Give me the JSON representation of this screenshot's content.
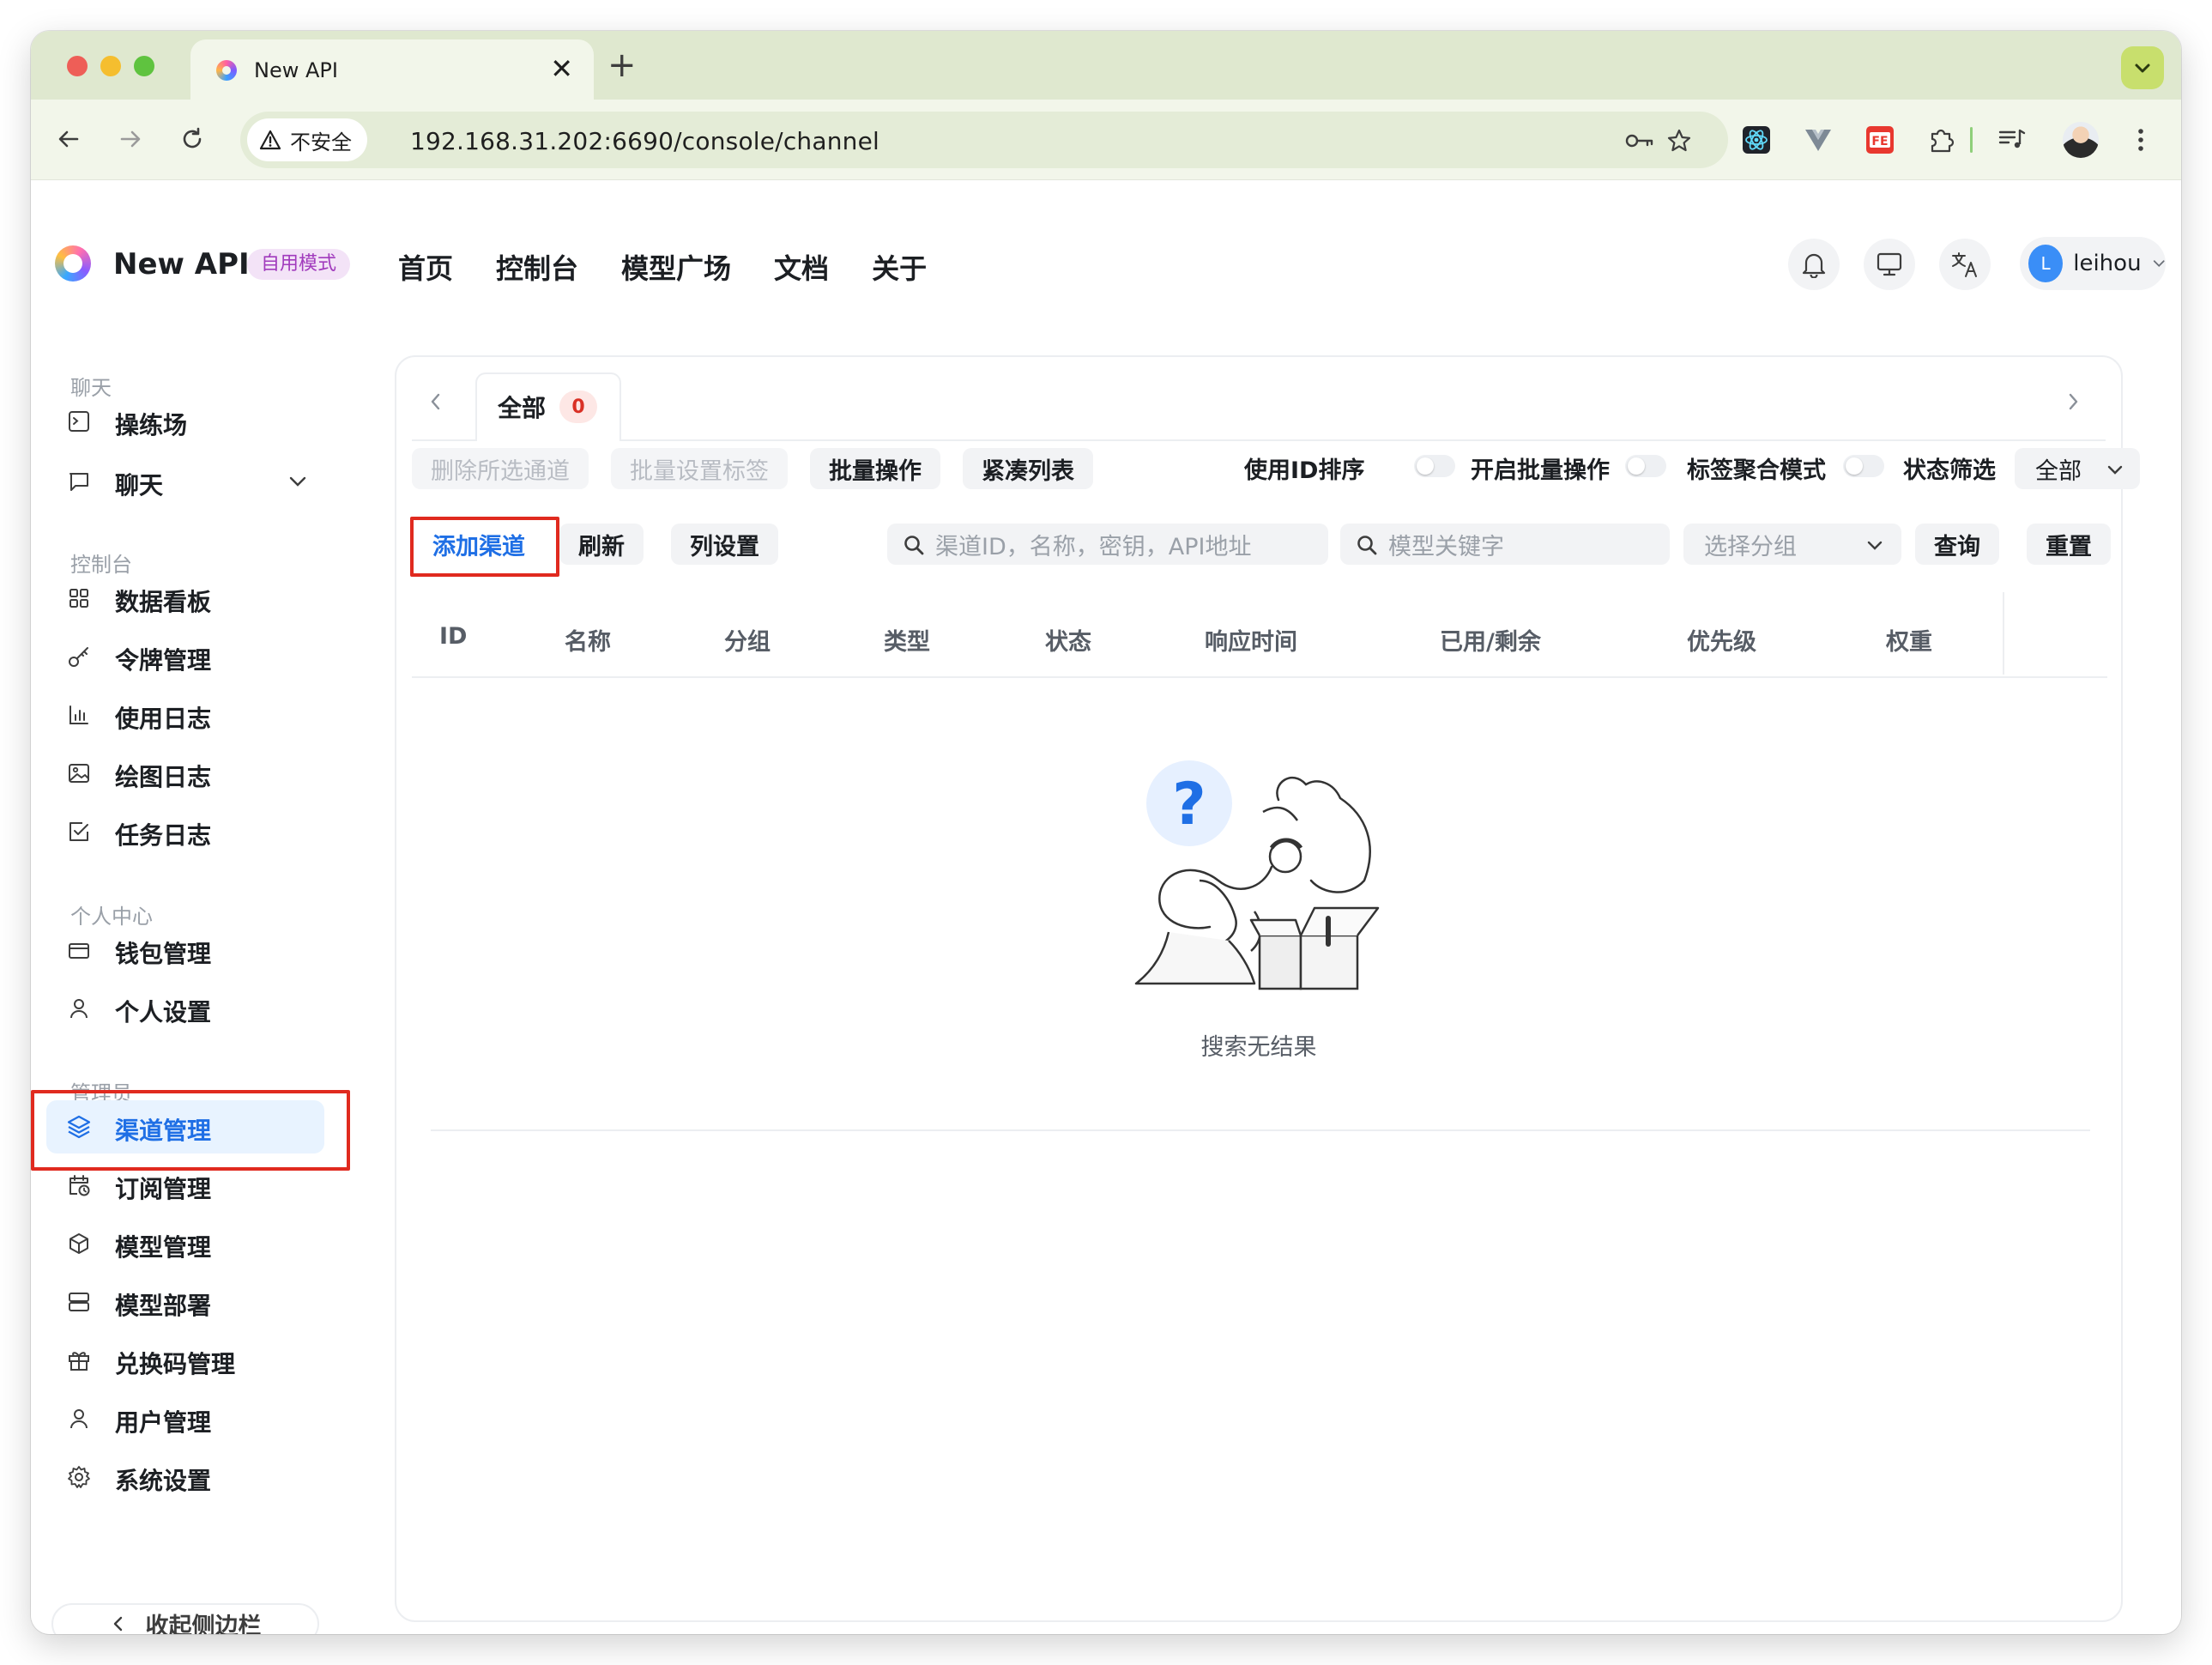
{
  "browser": {
    "tab_title": "New API",
    "tab_close": "✕",
    "new_tab": "+",
    "security_label": "不安全",
    "url": "192.168.31.202:6690/console/channel"
  },
  "header": {
    "brand": "New API",
    "brand_tag": "自用模式",
    "nav": [
      "首页",
      "控制台",
      "模型广场",
      "文档",
      "关于"
    ],
    "user_initial": "L",
    "user_name": "leihou"
  },
  "sidebar": {
    "groups": {
      "chat": "聊天",
      "console": "控制台",
      "personal": "个人中心",
      "admin": "管理员"
    },
    "items": {
      "playground": "操练场",
      "chat": "聊天",
      "dashboard": "数据看板",
      "tokens": "令牌管理",
      "usage_log": "使用日志",
      "drawing_log": "绘图日志",
      "task_log": "任务日志",
      "wallet": "钱包管理",
      "personal_settings": "个人设置",
      "channels": "渠道管理",
      "subscriptions": "订阅管理",
      "models": "模型管理",
      "deployment": "模型部署",
      "redemption": "兑换码管理",
      "users": "用户管理",
      "system_settings": "系统设置"
    },
    "collapse_label": "收起侧边栏"
  },
  "channel_page": {
    "tab_label": "全部",
    "tab_count": "0",
    "actions": {
      "delete_selected": "删除所选通道",
      "batch_tag": "批量设置标签",
      "batch_ops": "批量操作",
      "compact_list": "紧凑列表"
    },
    "toggles": {
      "sort_by_id": "使用ID排序",
      "enable_batch": "开启批量操作",
      "tag_aggregate": "标签聚合模式",
      "status_filter": "状态筛选"
    },
    "status_filter_value": "全部",
    "buttons": {
      "add_channel": "添加渠道",
      "refresh": "刷新",
      "column_settings": "列设置",
      "query": "查询",
      "reset": "重置"
    },
    "search_placeholder": "渠道ID，名称，密钥，API地址",
    "model_placeholder": "模型关键字",
    "group_select": "选择分组",
    "columns": [
      "ID",
      "名称",
      "分组",
      "类型",
      "状态",
      "响应时间",
      "已用/剩余",
      "优先级",
      "权重"
    ],
    "empty_text": "搜索无结果"
  },
  "colors": {
    "accent": "#1f6fe5",
    "highlight_box": "#e02a1f",
    "brand_tag": "#a13bbd"
  }
}
